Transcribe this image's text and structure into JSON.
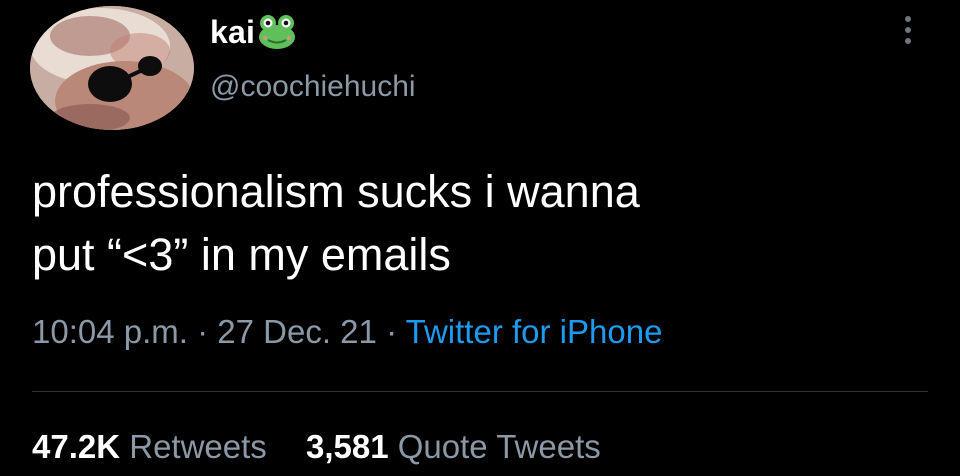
{
  "user": {
    "display_name": "kai",
    "name_emoji": "frog-icon",
    "handle": "@coochiehuchi",
    "avatar": "avatar"
  },
  "tweet": {
    "text_lines": [
      "professionalism sucks i wanna",
      "put “<3” in my emails"
    ],
    "time": "10:04 p.m.",
    "sep": "·",
    "date": "27 Dec. 21",
    "source": "Twitter for iPhone"
  },
  "stats": {
    "retweets_count": "47.2K",
    "retweets_label": "Retweets",
    "quotes_count": "3,581",
    "quotes_label": "Quote Tweets"
  },
  "colors": {
    "background": "#000000",
    "text": "#ffffff",
    "secondary": "#8b98a5",
    "link": "#1d9bf0",
    "frog": "#5fbf5a"
  }
}
